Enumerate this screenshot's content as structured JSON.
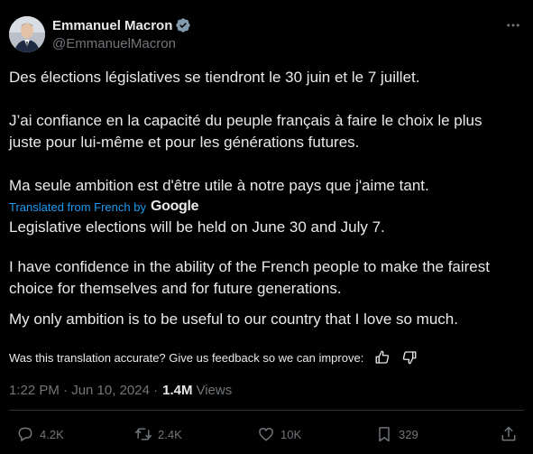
{
  "author": {
    "display_name": "Emmanuel Macron",
    "handle": "@EmmanuelMacron",
    "verified_color": "#829aab"
  },
  "tweet": {
    "original": [
      "Des élections législatives se tiendront le 30 juin et le 7 juillet.",
      "J’ai confiance en la capacité du peuple français à faire le choix le plus juste pour lui-même et pour les générations futures.",
      "Ma seule ambition est d'être utile à notre pays que j'aime tant."
    ],
    "translated_label": "Translated from French by",
    "translator": "Google",
    "translation": [
      "Legislative elections will be held on June 30 and July 7.",
      "I have confidence in the ability of the French people to make the fairest choice for themselves and for future generations.",
      "My only ambition is to be useful to our country that I love so much."
    ],
    "feedback_prompt": "Was this translation accurate? Give us feedback so we can improve:"
  },
  "meta": {
    "timestamp": "1:22 PM · Jun 10, 2024 · ",
    "views_count": "1.4M",
    "views_label": "Views"
  },
  "actions": {
    "replies": "4.2K",
    "reposts": "2.4K",
    "likes": "10K",
    "bookmarks": "329"
  },
  "colors": {
    "background": "#000000",
    "text": "#e7e9ea",
    "muted": "#71767b",
    "link": "#1d9bf0",
    "divider": "#2f3336"
  },
  "icons": [
    "verified-badge-icon",
    "more-icon",
    "thumbs-up-icon",
    "thumbs-down-icon",
    "reply-icon",
    "repost-icon",
    "like-icon",
    "bookmark-icon",
    "share-icon"
  ]
}
